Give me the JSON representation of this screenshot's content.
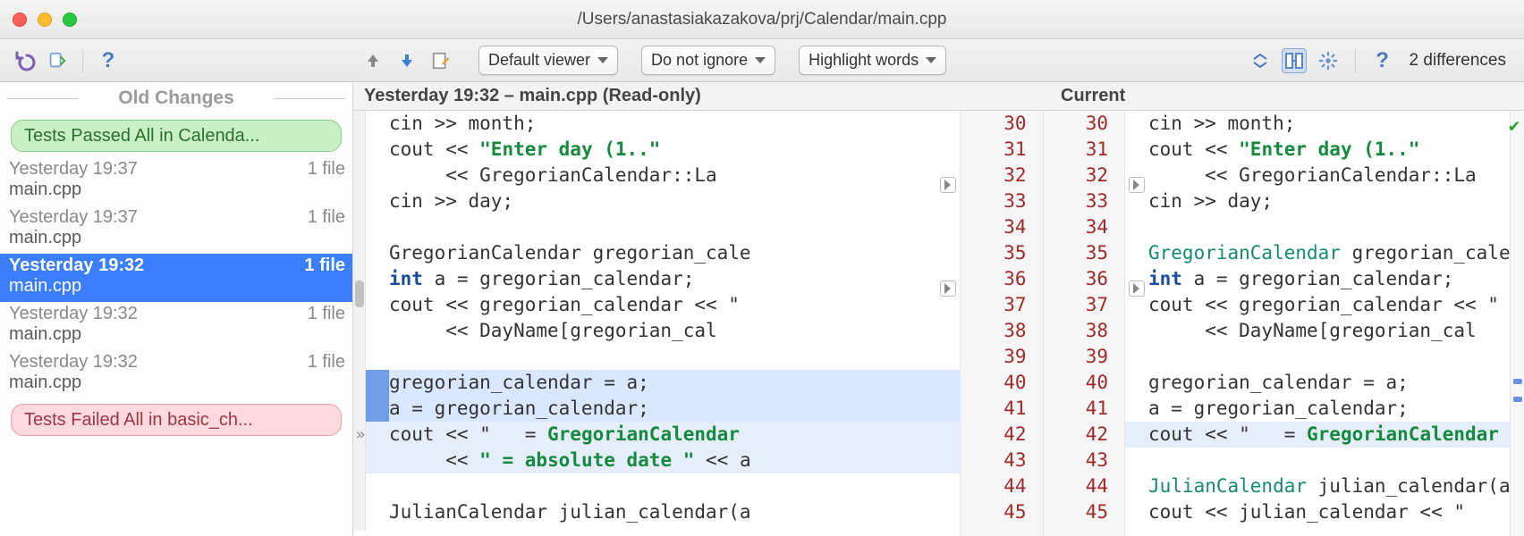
{
  "window": {
    "title": "/Users/anastasiakazakova/prj/Calendar/main.cpp"
  },
  "toolbar": {
    "viewer_dropdown": "Default viewer",
    "ignore_dropdown": "Do not ignore",
    "highlight_dropdown": "Highlight words",
    "diff_count": "2 differences"
  },
  "sidebar": {
    "section_title": "Old Changes",
    "passed_chip": "Tests Passed All in Calenda...",
    "failed_chip": "Tests Failed All in basic_ch...",
    "items": [
      {
        "time": "Yesterday 19:37",
        "files": "1 file",
        "name": "main.cpp",
        "selected": false
      },
      {
        "time": "Yesterday 19:37",
        "files": "1 file",
        "name": "main.cpp",
        "selected": false
      },
      {
        "time": "Yesterday 19:32",
        "files": "1 file",
        "name": "main.cpp",
        "selected": true
      },
      {
        "time": "Yesterday 19:32",
        "files": "1 file",
        "name": "main.cpp",
        "selected": false
      },
      {
        "time": "Yesterday 19:32",
        "files": "1 file",
        "name": "main.cpp",
        "selected": false
      }
    ]
  },
  "panes": {
    "left_title": "Yesterday 19:32 – main.cpp (Read-only)",
    "right_title": "Current"
  },
  "line_numbers": [
    "30",
    "31",
    "32",
    "33",
    "34",
    "35",
    "36",
    "37",
    "38",
    "39",
    "40",
    "41",
    "42",
    "43",
    "44",
    "45"
  ],
  "left_code": [
    {
      "t": "cin >> month;"
    },
    {
      "pre": "cout << ",
      "str": "\"Enter day (1..\""
    },
    {
      "t": "     << GregorianCalendar::La"
    },
    {
      "t": "cin >> day;"
    },
    {
      "t": ""
    },
    {
      "t": "GregorianCalendar gregorian_cale"
    },
    {
      "kwpre": "int",
      "t": " a = gregorian_calendar;"
    },
    {
      "t": "cout << gregorian_calendar << \" "
    },
    {
      "t": "     << DayName[gregorian_cal"
    },
    {
      "t": ""
    },
    {
      "t": "gregorian_calendar = a;",
      "cls": "hl-mod hl-mod-dark"
    },
    {
      "t": "a = gregorian_calendar;",
      "cls": "hl-mod hl-mod-dark"
    },
    {
      "pre": "cout << \"   = ",
      "str": "GregorianCalendar",
      "cls": "hl-del"
    },
    {
      "pre": "     << ",
      "str": "\" = absolute date \"",
      "post": " << a",
      "cls": "hl-del"
    },
    {
      "t": ""
    },
    {
      "t": "JulianCalendar julian_calendar(a"
    }
  ],
  "right_code": [
    {
      "t": "cin >> month;"
    },
    {
      "pre": "cout << ",
      "str": "\"Enter day (1..\""
    },
    {
      "t": "     << GregorianCalendar::La"
    },
    {
      "t": "cin >> day;"
    },
    {
      "t": ""
    },
    {
      "typepre": "GregorianCalendar",
      "t": " gregorian_cale"
    },
    {
      "kwpre": "int",
      "t": " a = gregorian_calendar;"
    },
    {
      "t": "cout << gregorian_calendar << \" "
    },
    {
      "t": "     << DayName[gregorian_cal"
    },
    {
      "t": ""
    },
    {
      "t": "gregorian_calendar = a;"
    },
    {
      "t": "a = gregorian_calendar;"
    },
    {
      "pre": "cout << \"   = ",
      "str": "GregorianCalendar",
      "cls": "hl-del"
    },
    {
      "t": ""
    },
    {
      "typepre": "JulianCalendar",
      "t": " julian_calendar(a"
    },
    {
      "t": "cout << julian_calendar << \" "
    }
  ]
}
